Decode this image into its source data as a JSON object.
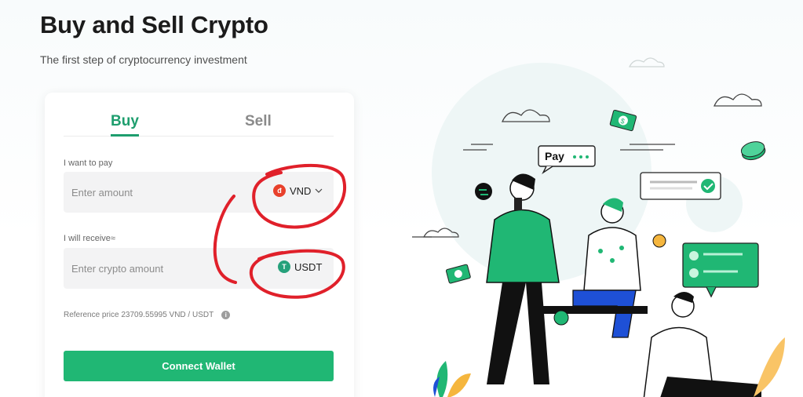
{
  "page": {
    "title": "Buy and Sell Crypto",
    "subtitle": "The first step of cryptocurrency investment"
  },
  "tabs": [
    {
      "label": "Buy",
      "active": true
    },
    {
      "label": "Sell",
      "active": false
    }
  ],
  "pay": {
    "label": "I want to pay",
    "placeholder": "Enter amount",
    "currency": "VND",
    "currency_icon": "vnd-coin-icon"
  },
  "receive": {
    "label": "I will receive≈",
    "placeholder": "Enter crypto amount",
    "currency": "USDT",
    "currency_icon": "tether-icon"
  },
  "reference_price": "Reference price 23709.55995 VND / USDT",
  "connect_button": "Connect Wallet",
  "illustration": {
    "pay_bubble": "Pay"
  },
  "colors": {
    "accent": "#20b774",
    "tab_active": "#1e9e6e",
    "annotation": "#e0202a"
  }
}
